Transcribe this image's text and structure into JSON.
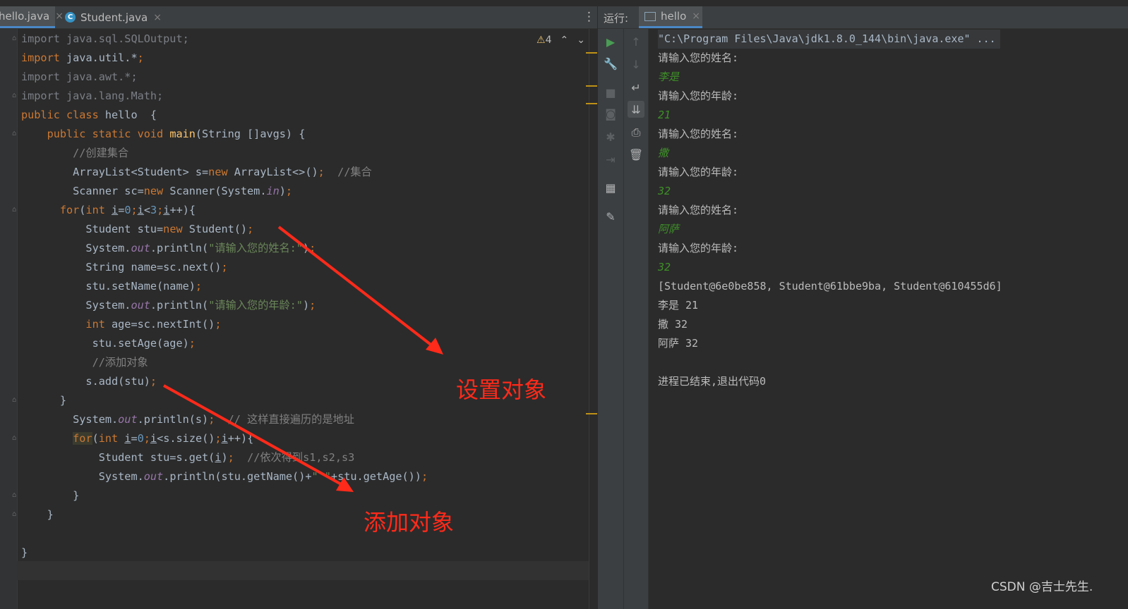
{
  "editor": {
    "tabs": [
      {
        "label": "hello.java",
        "active": true
      },
      {
        "label": "Student.java",
        "active": false
      }
    ],
    "close_glyph": "×",
    "inspection": {
      "warn_icon": "⚠",
      "count": "4",
      "up": "⌃",
      "down": "⌄"
    },
    "more_glyph": "⋮",
    "code_lines": [
      [
        {
          "t": "import java.sql.SQLOutput;",
          "c": "dim"
        }
      ],
      [
        {
          "t": "import ",
          "c": "kw"
        },
        {
          "t": "java.util.*",
          "c": ""
        },
        {
          "t": ";",
          "c": "kw"
        }
      ],
      [
        {
          "t": "import java.awt.*;",
          "c": "dim"
        }
      ],
      [
        {
          "t": "import java.lang.Math;",
          "c": "dim"
        }
      ],
      [
        {
          "t": "public class ",
          "c": "kw"
        },
        {
          "t": "hello  {",
          "c": ""
        }
      ],
      [
        {
          "t": "    public static void ",
          "c": "kw"
        },
        {
          "t": "main",
          "c": "fn"
        },
        {
          "t": "(String []avgs) {",
          "c": ""
        }
      ],
      [
        {
          "t": "        //创建集合",
          "c": "cm"
        }
      ],
      [
        {
          "t": "        ArrayList<Student> s=",
          "c": ""
        },
        {
          "t": "new ",
          "c": "kw"
        },
        {
          "t": "ArrayList<>()",
          "c": ""
        },
        {
          "t": ";  ",
          "c": "kw"
        },
        {
          "t": "//集合",
          "c": "cm"
        }
      ],
      [
        {
          "t": "        Scanner sc=",
          "c": ""
        },
        {
          "t": "new ",
          "c": "kw"
        },
        {
          "t": "Scanner(System.",
          "c": ""
        },
        {
          "t": "in",
          "c": "it"
        },
        {
          "t": ")",
          "c": ""
        },
        {
          "t": ";",
          "c": "kw"
        }
      ],
      [
        {
          "t": "      for",
          "c": "kw"
        },
        {
          "t": "(",
          "c": ""
        },
        {
          "t": "int ",
          "c": "kw"
        },
        {
          "t": "i",
          "c": "ul"
        },
        {
          "t": "=",
          "c": ""
        },
        {
          "t": "0",
          "c": "nm"
        },
        {
          "t": ";",
          "c": "kw"
        },
        {
          "t": "i",
          "c": "ul"
        },
        {
          "t": "<",
          "c": ""
        },
        {
          "t": "3",
          "c": "nm"
        },
        {
          "t": ";",
          "c": "kw"
        },
        {
          "t": "i",
          "c": "ul"
        },
        {
          "t": "++){",
          "c": ""
        }
      ],
      [
        {
          "t": "          Student stu=",
          "c": ""
        },
        {
          "t": "new ",
          "c": "kw"
        },
        {
          "t": "Student()",
          "c": ""
        },
        {
          "t": ";",
          "c": "kw"
        }
      ],
      [
        {
          "t": "          System.",
          "c": ""
        },
        {
          "t": "out",
          "c": "it"
        },
        {
          "t": ".println(",
          "c": ""
        },
        {
          "t": "\"请输入您的姓名:\"",
          "c": "st"
        },
        {
          "t": ")",
          "c": ""
        },
        {
          "t": ";",
          "c": "kw"
        }
      ],
      [
        {
          "t": "          String name=sc.next()",
          "c": ""
        },
        {
          "t": ";",
          "c": "kw"
        }
      ],
      [
        {
          "t": "          stu.setName(name)",
          "c": ""
        },
        {
          "t": ";",
          "c": "kw"
        }
      ],
      [
        {
          "t": "          System.",
          "c": ""
        },
        {
          "t": "out",
          "c": "it"
        },
        {
          "t": ".println(",
          "c": ""
        },
        {
          "t": "\"请输入您的年龄:\"",
          "c": "st"
        },
        {
          "t": ")",
          "c": ""
        },
        {
          "t": ";",
          "c": "kw"
        }
      ],
      [
        {
          "t": "          int ",
          "c": "kw"
        },
        {
          "t": "age=sc.nextInt()",
          "c": ""
        },
        {
          "t": ";",
          "c": "kw"
        }
      ],
      [
        {
          "t": "           stu.setAge(age)",
          "c": ""
        },
        {
          "t": ";",
          "c": "kw"
        }
      ],
      [
        {
          "t": "           //添加对象",
          "c": "cm"
        }
      ],
      [
        {
          "t": "          s.add(stu)",
          "c": ""
        },
        {
          "t": ";",
          "c": "kw"
        }
      ],
      [
        {
          "t": "      }",
          "c": ""
        }
      ],
      [
        {
          "t": "        System.",
          "c": ""
        },
        {
          "t": "out",
          "c": "it"
        },
        {
          "t": ".println(s)",
          "c": ""
        },
        {
          "t": ";  ",
          "c": "kw"
        },
        {
          "t": "// 这样直接遍历的是地址",
          "c": "cm"
        }
      ],
      [
        {
          "t": "        ",
          "c": ""
        },
        {
          "t": "for",
          "c": "kw hl"
        },
        {
          "t": "(",
          "c": ""
        },
        {
          "t": "int ",
          "c": "kw"
        },
        {
          "t": "i",
          "c": "ul"
        },
        {
          "t": "=",
          "c": ""
        },
        {
          "t": "0",
          "c": "nm"
        },
        {
          "t": ";",
          "c": "kw"
        },
        {
          "t": "i",
          "c": "ul"
        },
        {
          "t": "<s.size()",
          "c": ""
        },
        {
          "t": ";",
          "c": "kw"
        },
        {
          "t": "i",
          "c": "ul"
        },
        {
          "t": "++){",
          "c": ""
        }
      ],
      [
        {
          "t": "            Student stu=s.get(",
          "c": ""
        },
        {
          "t": "i",
          "c": "ul"
        },
        {
          "t": ")",
          "c": ""
        },
        {
          "t": ";  ",
          "c": "kw"
        },
        {
          "t": "//依次得到s1,s2,s3",
          "c": "cm"
        }
      ],
      [
        {
          "t": "            System.",
          "c": ""
        },
        {
          "t": "out",
          "c": "it"
        },
        {
          "t": ".println(stu.getName()+",
          "c": ""
        },
        {
          "t": "\" \"",
          "c": "st"
        },
        {
          "t": "+stu.getAge())",
          "c": ""
        },
        {
          "t": ";",
          "c": "kw"
        }
      ],
      [
        {
          "t": "        }",
          "c": ""
        }
      ],
      [
        {
          "t": "    }",
          "c": ""
        }
      ],
      [
        {
          "t": "",
          "c": ""
        }
      ],
      [
        {
          "t": "}",
          "c": ""
        }
      ]
    ]
  },
  "run": {
    "label": "运行:",
    "tab": "hello",
    "toolbar1": [
      "run-icon",
      "wrench-icon",
      "stop-icon",
      "camera-icon",
      "debug-icon",
      "login-icon",
      "layout-icon",
      "pin-icon"
    ],
    "toolbar2": [
      "up-arrow-icon",
      "down-arrow-icon",
      "soft-wrap-icon",
      "scroll-end-icon",
      "print-icon",
      "trash-icon"
    ],
    "console_lines": [
      {
        "t": "\"C:\\Program Files\\Java\\jdk1.8.0_144\\bin\\java.exe\" ...",
        "k": "cmd"
      },
      {
        "t": "请输入您的姓名:",
        "k": "out"
      },
      {
        "t": "李是",
        "k": "inp"
      },
      {
        "t": "请输入您的年龄:",
        "k": "out"
      },
      {
        "t": "21",
        "k": "inp"
      },
      {
        "t": "请输入您的姓名:",
        "k": "out"
      },
      {
        "t": "撒",
        "k": "inp"
      },
      {
        "t": "请输入您的年龄:",
        "k": "out"
      },
      {
        "t": "32",
        "k": "inp"
      },
      {
        "t": "请输入您的姓名:",
        "k": "out"
      },
      {
        "t": "阿萨",
        "k": "inp"
      },
      {
        "t": "请输入您的年龄:",
        "k": "out"
      },
      {
        "t": "32",
        "k": "inp"
      },
      {
        "t": "[Student@6e0be858, Student@61bbe9ba, Student@610455d6]",
        "k": "out"
      },
      {
        "t": "李是 21",
        "k": "out"
      },
      {
        "t": "撒 32",
        "k": "out"
      },
      {
        "t": "阿萨 32",
        "k": "out"
      },
      {
        "t": "",
        "k": "out"
      },
      {
        "t": "进程已结束,退出代码0",
        "k": "out"
      }
    ]
  },
  "annotations": {
    "set_object": "设置对象",
    "add_object": "添加对象",
    "arrow_color": "#ff2a1a"
  },
  "watermark": "CSDN @吉士先生."
}
